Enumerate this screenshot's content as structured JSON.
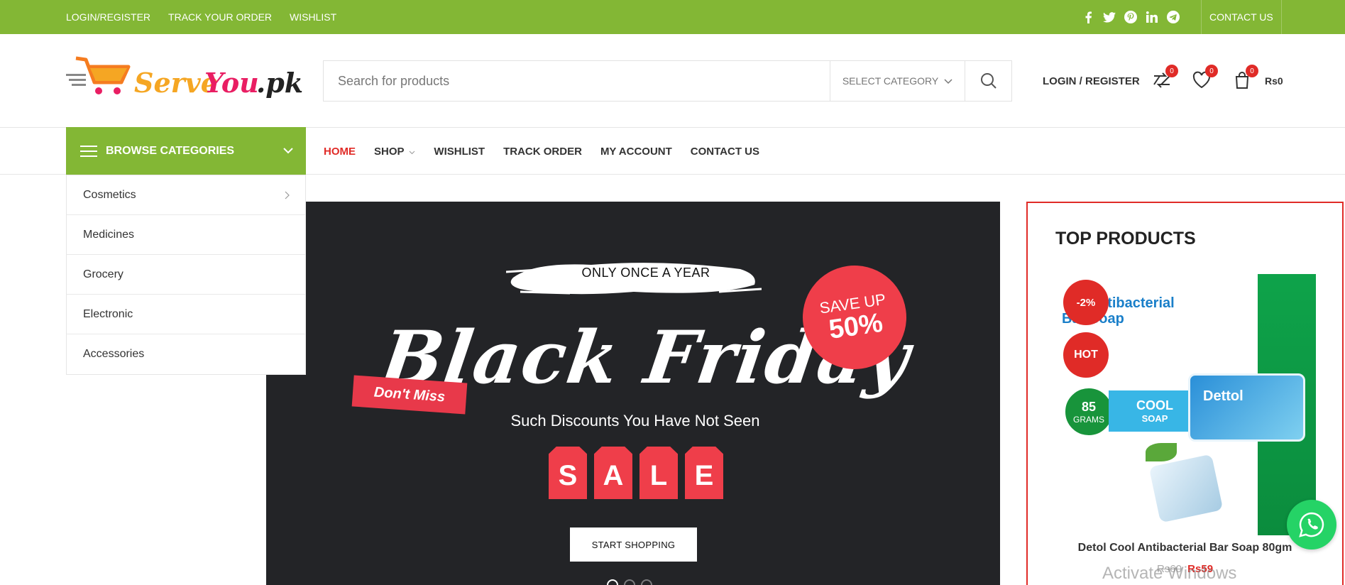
{
  "topbar": {
    "links": [
      "LOGIN/REGISTER",
      "TRACK YOUR ORDER",
      "WISHLIST"
    ],
    "social": [
      "facebook-icon",
      "twitter-icon",
      "pinterest-icon",
      "linkedin-icon",
      "telegram-icon"
    ],
    "contact": "CONTACT US",
    "bg_color": "#83b735"
  },
  "header": {
    "logo_text": "ServeYou.pk",
    "search_placeholder": "Search for products",
    "category_select": "SELECT CATEGORY",
    "login": "LOGIN / REGISTER",
    "compare_count": "0",
    "wishlist_count": "0",
    "cart_count": "0",
    "cart_total": "Rs0"
  },
  "nav": {
    "browse_label": "BROWSE CATEGORIES",
    "menu": [
      "HOME",
      "SHOP",
      "WISHLIST",
      "TRACK ORDER",
      "MY ACCOUNT",
      "CONTACT US"
    ],
    "active": "HOME"
  },
  "categories": [
    "Cosmetics",
    "Medicines",
    "Grocery",
    "Electronic",
    "Accessories"
  ],
  "hero": {
    "tagline": "ONLY ONCE A YEAR",
    "headline": "Black Friday",
    "dont_miss": "Don't Miss",
    "save_up": "SAVE UP",
    "save_pct": "50%",
    "subtitle": "Such Discounts You Have Not Seen",
    "sale_letters": [
      "S",
      "A",
      "L",
      "E"
    ],
    "cta": "START SHOPPING"
  },
  "top_products": {
    "title": "TOP PRODUCTS",
    "product": {
      "discount_badge": "-2%",
      "hot_badge": "HOT",
      "pack_text_1": "ntibacterial",
      "pack_text_2": "Bar Soap",
      "grams_number": "85",
      "grams_unit": "GRAMS",
      "cool_a": "COOL",
      "cool_b": "SOAP",
      "soap_brand": "Dettol",
      "name": "Detol Cool Antibacterial Bar Soap 80gm",
      "old_price": "Rs60",
      "new_price": "Rs59"
    }
  },
  "watermark": "Activate Windows"
}
